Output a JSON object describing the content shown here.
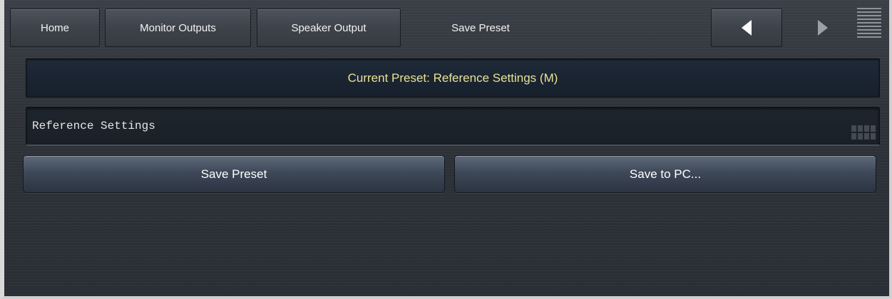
{
  "nav": {
    "home_label": "Home",
    "monitor_outputs_label": "Monitor Outputs",
    "speaker_output_label": "Speaker Output",
    "current_page_label": "Save Preset"
  },
  "main": {
    "current_preset_text": "Current Preset: Reference Settings (M)",
    "preset_name_value": "Reference Settings",
    "save_preset_label": "Save Preset",
    "save_to_pc_label": "Save to PC..."
  },
  "icons": {
    "back": "triangle-left-icon",
    "forward": "triangle-right-icon",
    "menu": "hamburger-menu-icon",
    "keyboard": "keyboard-icon"
  },
  "colors": {
    "banner_text": "#e8e296",
    "background": "#2e3239"
  }
}
